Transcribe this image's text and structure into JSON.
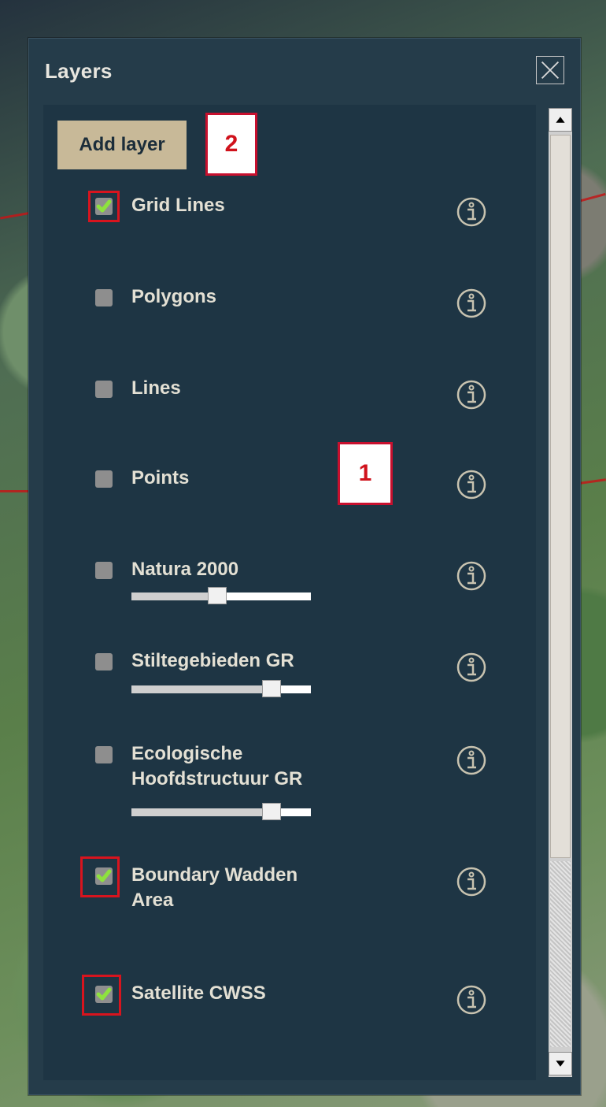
{
  "panel": {
    "title": "Layers",
    "add_layer_label": "Add layer"
  },
  "callouts": {
    "first": "1",
    "second": "2"
  },
  "layers": [
    {
      "name": "Grid Lines",
      "checked": true
    },
    {
      "name": "Polygons",
      "checked": false
    },
    {
      "name": "Lines",
      "checked": false
    },
    {
      "name": "Points",
      "checked": false
    },
    {
      "name": "Natura 2000",
      "checked": false,
      "opacity": 0.48
    },
    {
      "name": "Stiltegebieden GR",
      "checked": false,
      "opacity": 0.78
    },
    {
      "name": "Ecologische Hoofdstructuur GR",
      "checked": false,
      "opacity": 0.78
    },
    {
      "name": "Boundary Wadden Area",
      "checked": true
    },
    {
      "name": "Satellite CWSS",
      "checked": true
    }
  ],
  "colors": {
    "panel": "#253c4a",
    "check": "#8ee23e",
    "highlight": "#d8141e"
  },
  "icons": {
    "close": "close-icon",
    "info": "info-icon",
    "scroll_up": "arrow-up-icon",
    "scroll_down": "arrow-down-icon"
  }
}
